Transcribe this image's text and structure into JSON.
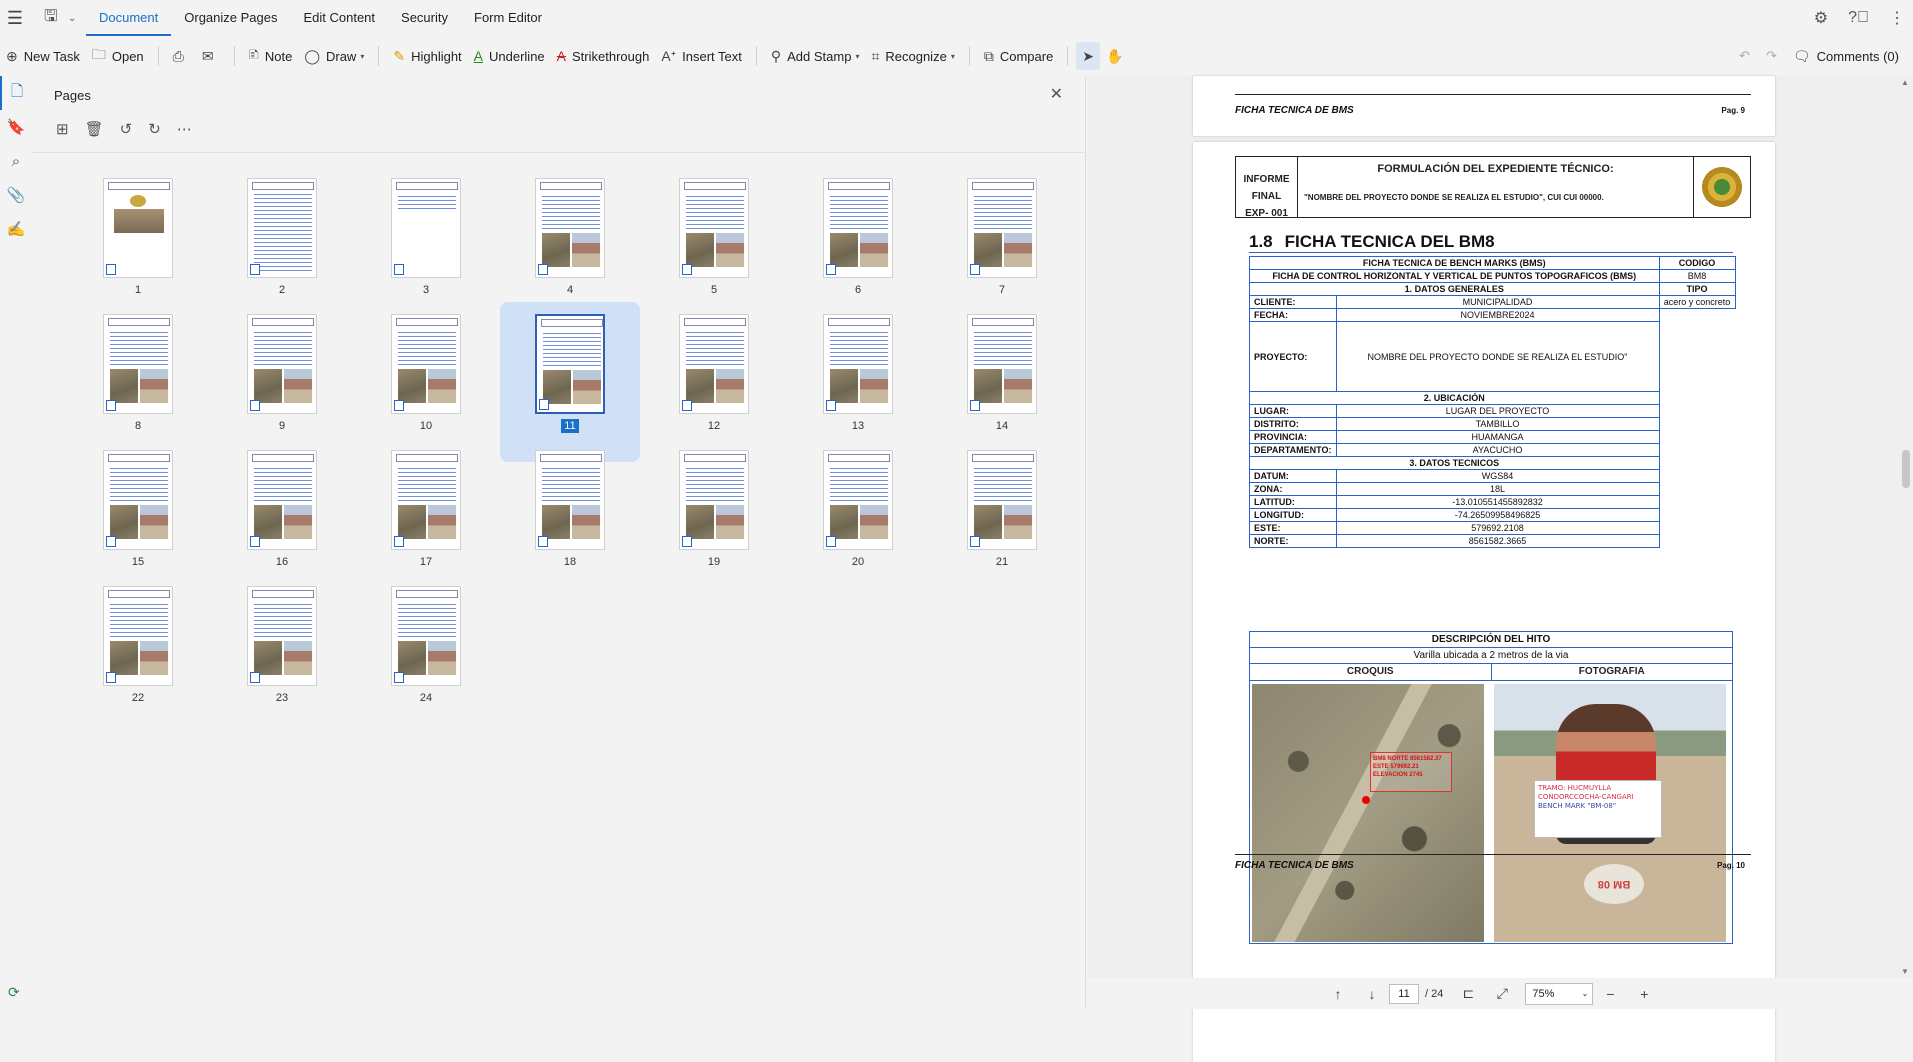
{
  "menubar": {
    "tabs": [
      "Document",
      "Organize Pages",
      "Edit Content",
      "Security",
      "Form Editor"
    ],
    "active_tab": "Document"
  },
  "toolbar": {
    "new_task": "New Task",
    "open": "Open",
    "note": "Note",
    "draw": "Draw",
    "highlight": "Highlight",
    "underline": "Underline",
    "strikethrough": "Strikethrough",
    "insert_text": "Insert Text",
    "add_stamp": "Add Stamp",
    "recognize": "Recognize",
    "compare": "Compare",
    "comments": "Comments (0)"
  },
  "pages_panel": {
    "title": "Pages",
    "page_numbers": [
      "1",
      "2",
      "3",
      "4",
      "5",
      "6",
      "7",
      "8",
      "9",
      "10",
      "11",
      "12",
      "13",
      "14",
      "15",
      "16",
      "17",
      "18",
      "19",
      "20",
      "21",
      "22",
      "23",
      "24"
    ],
    "selected_page": "11"
  },
  "document": {
    "prev_footer_title": "FICHA TECNICA DE BMS",
    "prev_footer_page": "Pag. 9",
    "header": {
      "left_line1": "INFORME FINAL",
      "left_line2": "EXP- 001",
      "title": "FORMULACIÓN DEL EXPEDIENTE TÉCNICO:",
      "subtitle": "\"NOMBRE DEL PROYECTO DONDE SE REALIZA EL ESTUDIO\", CUI CUI 00000."
    },
    "section_number": "1.8",
    "section_title": "FICHA TECNICA DEL BM8",
    "table": {
      "title": "FICHA TECNICA DE BENCH MARKS (BMS)",
      "subtitle": "FICHA DE CONTROL HORIZONTAL Y VERTICAL DE PUNTOS TOPOGRAFICOS (BMS)",
      "codigo_label": "CODIGO",
      "codigo_value": "BM8",
      "tipo_label": "TIPO",
      "tipo_value": "acero y concreto",
      "sec1": "1. DATOS GENERALES",
      "cliente_k": "CLIENTE:",
      "cliente_v": "MUNICIPALIDAD",
      "fecha_k": "FECHA:",
      "fecha_v": "NOVIEMBRE2024",
      "proyecto_k": "PROYECTO:",
      "proyecto_v": "NOMBRE DEL PROYECTO DONDE SE REALIZA EL ESTUDIO\"",
      "sec2": "2. UBICACIÓN",
      "lugar_k": "LUGAR:",
      "lugar_v": "LUGAR DEL PROYECTO",
      "distrito_k": "DISTRITO:",
      "distrito_v": "TAMBILLO",
      "provincia_k": "PROVINCIA:",
      "provincia_v": "HUAMANGA",
      "departamento_k": "DEPARTAMENTO:",
      "departamento_v": "AYACUCHO",
      "sec3": "3. DATOS TECNICOS",
      "datum_k": "DATUM:",
      "datum_v": "WGS84",
      "zona_k": "ZONA:",
      "zona_v": "18L",
      "latitud_k": "LATITUD:",
      "latitud_v": "-13.010551455892832",
      "longitud_k": "LONGITUD:",
      "longitud_v": "-74.26509958496825",
      "este_k": "ESTE:",
      "este_v": "579692.2108",
      "norte_k": "NORTE:",
      "norte_v": "8561582.3665"
    },
    "hito": {
      "title": "DESCRIPCIÓN DEL HITO",
      "desc": "Varilla ubicada a 2 metros de la via",
      "croquis": "CROQUIS",
      "fotografia": "FOTOGRAFIA",
      "croquis_label": "BM8 NORTE 8561582.37 ESTE 579692.21 ELEVACION 2745",
      "sign_line1": "TRAMO: HUCMUYLLA",
      "sign_line2": "CONDORCCOCHA-CANGARI",
      "sign_line3": "BENCH MARK \"BM-08\"",
      "stone_text": "BM 08"
    },
    "footer_title": "FICHA TECNICA DE BMS",
    "footer_page": "Pag. 10"
  },
  "bottombar": {
    "current_page": "11",
    "total": "/ 24",
    "zoom": "75%"
  }
}
